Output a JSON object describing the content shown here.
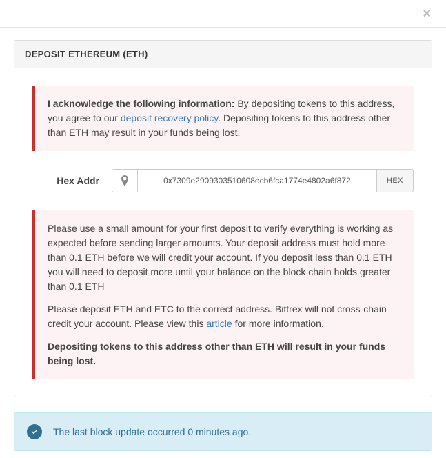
{
  "close_glyph": "×",
  "panel": {
    "title": "DEPOSIT ETHEREUM (ETH)"
  },
  "ack": {
    "lead": "I acknowledge the following information:",
    "text_before": " By depositing tokens to this address, you agree to our ",
    "link": "deposit recovery policy",
    "text_after": ". Depositing tokens to this address other than ETH may result in your funds being lost."
  },
  "form": {
    "label": "Hex Addr",
    "address": "0x7309e2909303510608ecb6fca1774e4802a6f872",
    "hex_btn": "HEX"
  },
  "notes": {
    "p1": "Please use a small amount for your first deposit to verify everything is working as expected before sending larger amounts. Your deposit address must hold more than 0.1 ETH before we will credit your account. If you deposit less than 0.1 ETH you will need to deposit more until your balance on the block chain holds greater than 0.1 ETH",
    "p2_before": "Please deposit ETH and ETC to the correct address. Bittrex will not cross-chain credit your account. Please view this ",
    "p2_link": "article",
    "p2_after": " for more information.",
    "p3": "Depositing tokens to this address other than ETH will result in your funds being lost."
  },
  "status": {
    "text": "The last block update occurred 0 minutes ago."
  }
}
